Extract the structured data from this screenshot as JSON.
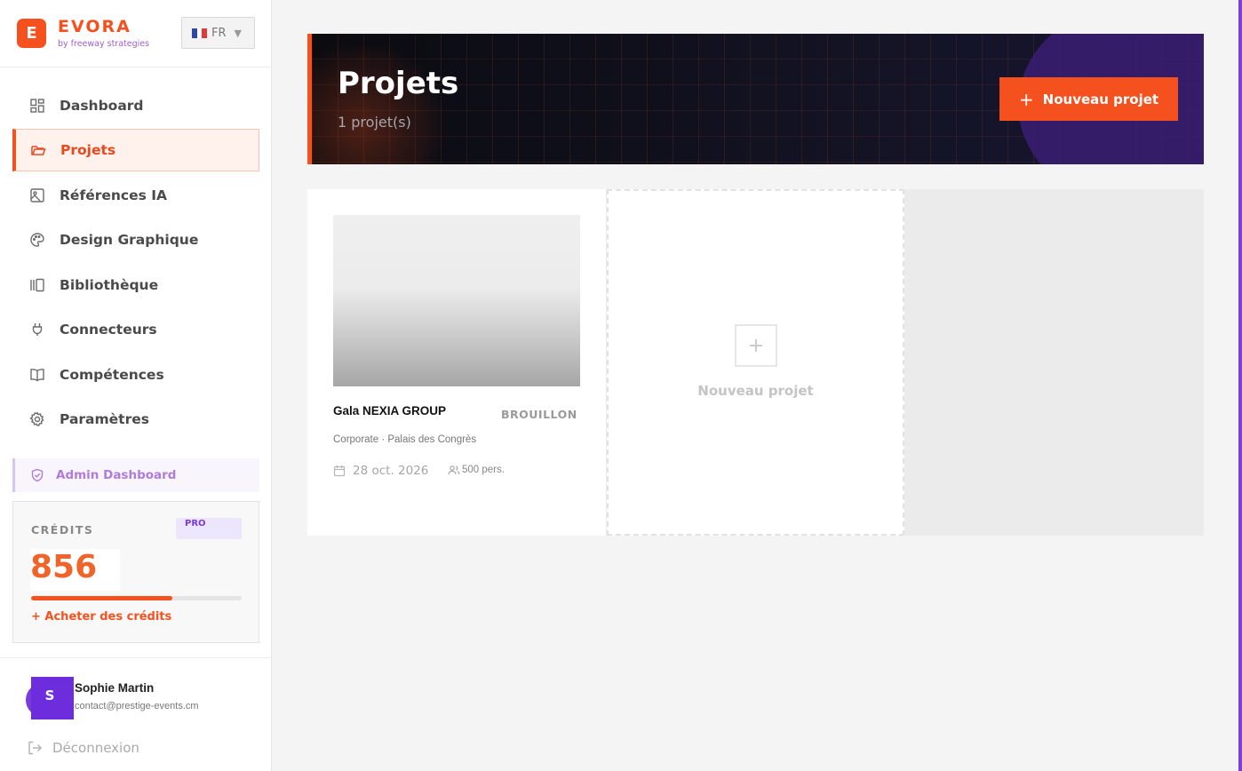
{
  "brand": {
    "logo_letter": "E",
    "name": "EVORA",
    "tagline": "by freeway strategies"
  },
  "language": {
    "selected": "FR",
    "flag": "fr-flag-icon"
  },
  "nav": {
    "items": [
      {
        "label": "Dashboard",
        "icon": "dashboard-icon"
      },
      {
        "label": "Projets",
        "icon": "folder-icon",
        "active": true
      },
      {
        "label": "Références IA",
        "icon": "image-icon"
      },
      {
        "label": "Design Graphique",
        "icon": "palette-icon"
      },
      {
        "label": "Bibliothèque",
        "icon": "library-icon"
      },
      {
        "label": "Connecteurs",
        "icon": "plug-icon"
      },
      {
        "label": "Compétences",
        "icon": "book-icon"
      },
      {
        "label": "Paramètres",
        "icon": "gear-icon"
      }
    ],
    "admin": {
      "label": "Admin Dashboard",
      "icon": "shield-icon"
    }
  },
  "credits": {
    "label": "CRÉDITS",
    "plan": "PRO",
    "value": "856",
    "bar_fraction": 0.67,
    "buy_label": "+ Acheter des crédits"
  },
  "user": {
    "initial": "S",
    "name": "Sophie Martin",
    "email": "contact@prestige-events.cm",
    "logout_label": "Déconnexion"
  },
  "header": {
    "title": "Projets",
    "count": "1 projet(s)",
    "new_button": "Nouveau projet"
  },
  "projects": [
    {
      "title": "Gala NEXIA GROUP",
      "status": "BROUILLON",
      "meta": "Corporate · Palais des Congrès",
      "date": "28 oct. 2026",
      "people": "500 pers."
    }
  ],
  "new_project_card": {
    "label": "Nouveau projet"
  },
  "colors": {
    "accent": "#f4511e",
    "purple": "#6d2ddc",
    "hero_bg": "#0b0b10"
  }
}
